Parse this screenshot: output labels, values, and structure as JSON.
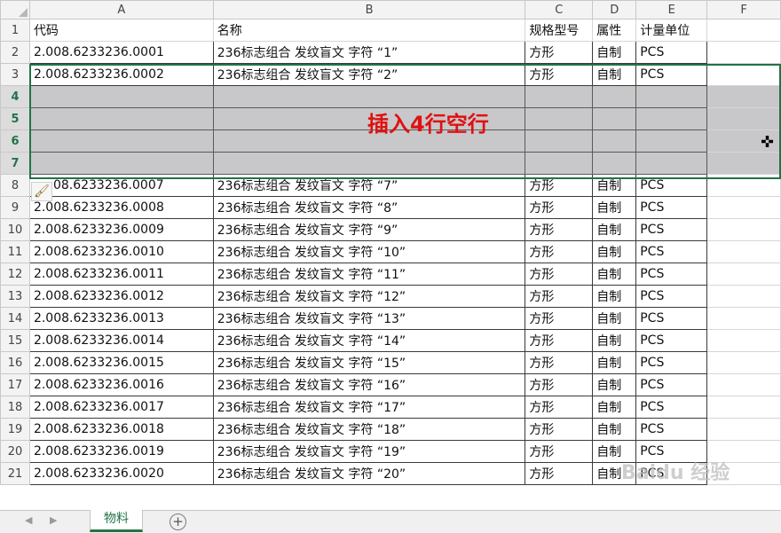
{
  "columns": [
    "A",
    "B",
    "C",
    "D",
    "E",
    "F"
  ],
  "header_row": [
    "代码",
    "名称",
    "规格型号",
    "属性",
    "计量单位",
    ""
  ],
  "rows": [
    {
      "n": "2",
      "a": "2.008.6233236.0001",
      "b": "236标志组合 发纹盲文 字符 “1”",
      "c": "方形",
      "d": "自制",
      "e": "PCS"
    },
    {
      "n": "3",
      "a": "2.008.6233236.0002",
      "b": "236标志组合 发纹盲文 字符 “2”",
      "c": "方形",
      "d": "自制",
      "e": "PCS"
    },
    {
      "n": "4",
      "a": "",
      "b": "",
      "c": "",
      "d": "",
      "e": ""
    },
    {
      "n": "5",
      "a": "",
      "b": "",
      "c": "",
      "d": "",
      "e": ""
    },
    {
      "n": "6",
      "a": "",
      "b": "",
      "c": "",
      "d": "",
      "e": ""
    },
    {
      "n": "7",
      "a": "",
      "b": "",
      "c": "",
      "d": "",
      "e": ""
    },
    {
      "n": "8",
      "a": "08.6233236.0007",
      "b": "236标志组合 发纹盲文 字符 “7”",
      "c": "方形",
      "d": "自制",
      "e": "PCS"
    },
    {
      "n": "9",
      "a": "2.008.6233236.0008",
      "b": "236标志组合 发纹盲文 字符 “8”",
      "c": "方形",
      "d": "自制",
      "e": "PCS"
    },
    {
      "n": "10",
      "a": "2.008.6233236.0009",
      "b": "236标志组合 发纹盲文 字符 “9”",
      "c": "方形",
      "d": "自制",
      "e": "PCS"
    },
    {
      "n": "11",
      "a": "2.008.6233236.0010",
      "b": "236标志组合 发纹盲文 字符 “10”",
      "c": "方形",
      "d": "自制",
      "e": "PCS"
    },
    {
      "n": "12",
      "a": "2.008.6233236.0011",
      "b": "236标志组合 发纹盲文 字符 “11”",
      "c": "方形",
      "d": "自制",
      "e": "PCS"
    },
    {
      "n": "13",
      "a": "2.008.6233236.0012",
      "b": "236标志组合 发纹盲文 字符 “12”",
      "c": "方形",
      "d": "自制",
      "e": "PCS"
    },
    {
      "n": "14",
      "a": "2.008.6233236.0013",
      "b": "236标志组合 发纹盲文 字符 “13”",
      "c": "方形",
      "d": "自制",
      "e": "PCS"
    },
    {
      "n": "15",
      "a": "2.008.6233236.0014",
      "b": "236标志组合 发纹盲文 字符 “14”",
      "c": "方形",
      "d": "自制",
      "e": "PCS"
    },
    {
      "n": "16",
      "a": "2.008.6233236.0015",
      "b": "236标志组合 发纹盲文 字符 “15”",
      "c": "方形",
      "d": "自制",
      "e": "PCS"
    },
    {
      "n": "17",
      "a": "2.008.6233236.0016",
      "b": "236标志组合 发纹盲文 字符 “16”",
      "c": "方形",
      "d": "自制",
      "e": "PCS"
    },
    {
      "n": "18",
      "a": "2.008.6233236.0017",
      "b": "236标志组合 发纹盲文 字符 “17”",
      "c": "方形",
      "d": "自制",
      "e": "PCS"
    },
    {
      "n": "19",
      "a": "2.008.6233236.0018",
      "b": "236标志组合 发纹盲文 字符 “18”",
      "c": "方形",
      "d": "自制",
      "e": "PCS"
    },
    {
      "n": "20",
      "a": "2.008.6233236.0019",
      "b": "236标志组合 发纹盲文 字符 “19”",
      "c": "方形",
      "d": "自制",
      "e": "PCS"
    },
    {
      "n": "21",
      "a": "2.008.6233236.0020",
      "b": "236标志组合 发纹盲文 字符 “20”",
      "c": "方形",
      "d": "自制",
      "e": "PCS"
    }
  ],
  "selected_rows": [
    "4",
    "5",
    "6",
    "7"
  ],
  "annotation": "插入4行空行",
  "sheet_tab": "物料",
  "watermark": "Baidu 经验",
  "icons": {
    "paste_options": "paste-options-icon",
    "move_cursor": "move-cursor-icon",
    "add_sheet": "plus-circle-icon",
    "scroll_left": "scroll-left-icon",
    "scroll_right": "scroll-right-icon"
  },
  "colors": {
    "accent": "#217346",
    "selection_fill": "#c8c7c9",
    "annotation": "#e01010"
  }
}
